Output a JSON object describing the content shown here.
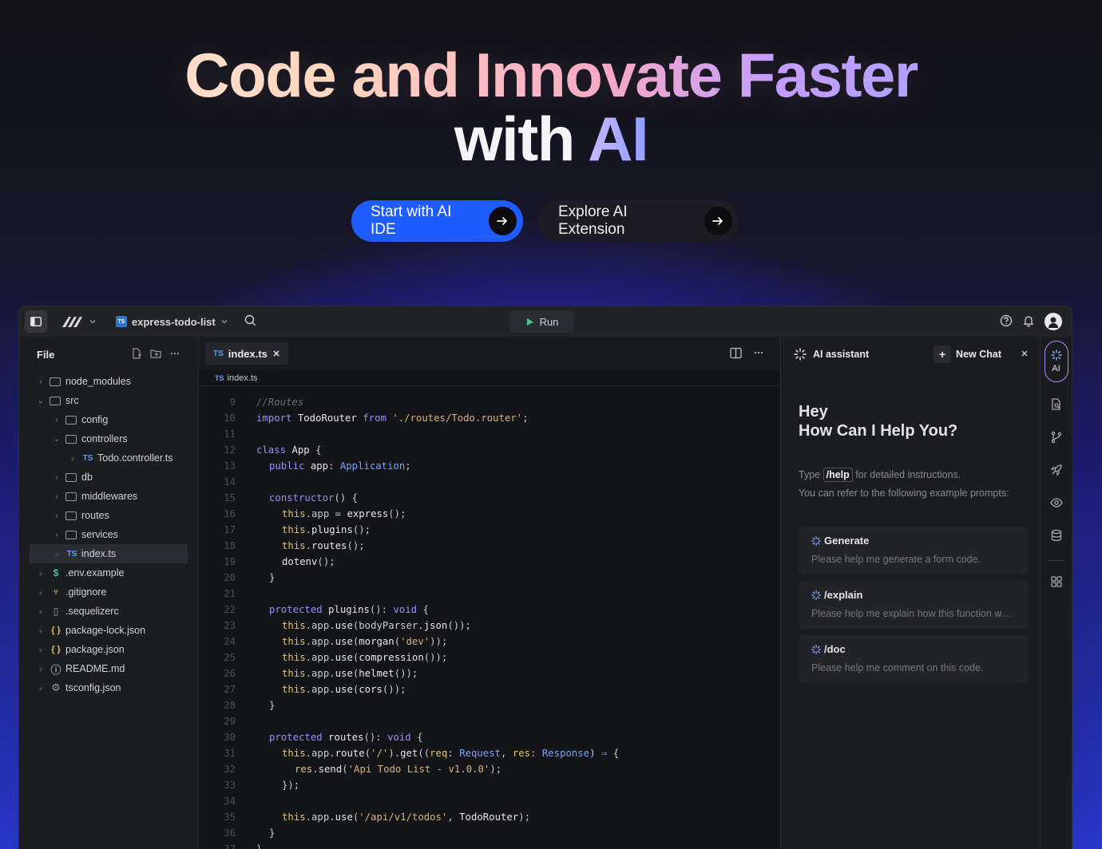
{
  "hero": {
    "title_line1_part1": "Code and Innovate Faster",
    "title_line2_part1": "with ",
    "title_line2_part2": "AI",
    "primary_cta": "Start with AI IDE",
    "secondary_cta": "Explore AI Extension"
  },
  "titlebar": {
    "project": "express-todo-list",
    "run": "Run"
  },
  "sidebar": {
    "title": "File",
    "tree": [
      {
        "label": "node_modules",
        "type": "folder",
        "depth": 0,
        "open": false
      },
      {
        "label": "src",
        "type": "folder",
        "depth": 0,
        "open": true
      },
      {
        "label": "config",
        "type": "folder",
        "depth": 1,
        "open": false
      },
      {
        "label": "controllers",
        "type": "folder",
        "depth": 1,
        "open": true
      },
      {
        "label": "Todo.controller.ts",
        "type": "ts",
        "depth": 2
      },
      {
        "label": "db",
        "type": "folder",
        "depth": 1,
        "open": false
      },
      {
        "label": "middlewares",
        "type": "folder",
        "depth": 1,
        "open": false
      },
      {
        "label": "routes",
        "type": "folder",
        "depth": 1,
        "open": false
      },
      {
        "label": "services",
        "type": "folder",
        "depth": 1,
        "open": false
      },
      {
        "label": "index.ts",
        "type": "ts",
        "depth": 1,
        "active": true
      },
      {
        "label": ".env.example",
        "type": "env",
        "depth": 0
      },
      {
        "label": ".gitignore",
        "type": "git",
        "depth": 0
      },
      {
        "label": ".sequelizerc",
        "type": "file",
        "depth": 0
      },
      {
        "label": "package-lock.json",
        "type": "json",
        "depth": 0
      },
      {
        "label": "package.json",
        "type": "json",
        "depth": 0
      },
      {
        "label": "README.md",
        "type": "md",
        "depth": 0
      },
      {
        "label": "tsconfig.json",
        "type": "config",
        "depth": 0
      }
    ]
  },
  "editor": {
    "tab": "index.ts",
    "tab_badge": "TS",
    "breadcrumb": "index.ts",
    "lines": [
      {
        "n": "9",
        "indent": 0,
        "html": "<span class='c'>//Routes</span>"
      },
      {
        "n": "10",
        "indent": 0,
        "html": "<span class='k'>import</span> <span class='f'>TodoRouter</span> <span class='k'>from</span> <span class='s'>'./routes/Todo.router'</span><span class='p'>;</span>"
      },
      {
        "n": "11",
        "indent": 0,
        "html": ""
      },
      {
        "n": "12",
        "indent": 0,
        "html": "<span class='k'>class</span> <span class='f'>App</span> <span class='p'>{</span>"
      },
      {
        "n": "13",
        "indent": 1,
        "html": "<span class='k'>public</span> <span class='f'>app</span><span class='p'>:</span> <span class='t'>Application</span><span class='p'>;</span>"
      },
      {
        "n": "14",
        "indent": 0,
        "html": ""
      },
      {
        "n": "15",
        "indent": 1,
        "html": "<span class='k'>constructor</span><span class='p'>() {</span>"
      },
      {
        "n": "16",
        "indent": 2,
        "html": "<span class='th'>this</span><span class='p'>.app = </span><span class='f'>express</span><span class='p'>();</span>"
      },
      {
        "n": "17",
        "indent": 2,
        "html": "<span class='th'>this</span><span class='p'>.</span><span class='f'>plugins</span><span class='p'>();</span>"
      },
      {
        "n": "18",
        "indent": 2,
        "html": "<span class='th'>this</span><span class='p'>.</span><span class='f'>routes</span><span class='p'>();</span>"
      },
      {
        "n": "19",
        "indent": 2,
        "html": "<span class='f'>dotenv</span><span class='p'>();</span>"
      },
      {
        "n": "20",
        "indent": 1,
        "html": "<span class='p'>}</span>"
      },
      {
        "n": "21",
        "indent": 0,
        "html": ""
      },
      {
        "n": "22",
        "indent": 1,
        "html": "<span class='k'>protected</span> <span class='f'>plugins</span><span class='p'>():</span> <span class='k'>void</span> <span class='p'>{</span>"
      },
      {
        "n": "23",
        "indent": 2,
        "html": "<span class='th'>this</span><span class='p'>.app.</span><span class='f'>use</span><span class='p'>(bodyParser.</span><span class='f'>json</span><span class='p'>());</span>"
      },
      {
        "n": "24",
        "indent": 2,
        "html": "<span class='th'>this</span><span class='p'>.app.</span><span class='f'>use</span><span class='p'>(</span><span class='f'>morgan</span><span class='p'>(</span><span class='s'>'dev'</span><span class='p'>));</span>"
      },
      {
        "n": "25",
        "indent": 2,
        "html": "<span class='th'>this</span><span class='p'>.app.</span><span class='f'>use</span><span class='p'>(</span><span class='f'>compression</span><span class='p'>());</span>"
      },
      {
        "n": "26",
        "indent": 2,
        "html": "<span class='th'>this</span><span class='p'>.app.</span><span class='f'>use</span><span class='p'>(</span><span class='f'>helmet</span><span class='p'>());</span>"
      },
      {
        "n": "27",
        "indent": 2,
        "html": "<span class='th'>this</span><span class='p'>.app.</span><span class='f'>use</span><span class='p'>(</span><span class='f'>cors</span><span class='p'>());</span>"
      },
      {
        "n": "28",
        "indent": 1,
        "html": "<span class='p'>}</span>"
      },
      {
        "n": "29",
        "indent": 0,
        "html": ""
      },
      {
        "n": "30",
        "indent": 1,
        "html": "<span class='k'>protected</span> <span class='f'>routes</span><span class='p'>():</span> <span class='k'>void</span> <span class='p'>{</span>"
      },
      {
        "n": "31",
        "indent": 2,
        "html": "<span class='th'>this</span><span class='p'>.app.</span><span class='f'>route</span><span class='p'>(</span><span class='s'>'/'</span><span class='p'>).</span><span class='f'>get</span><span class='p'>((</span><span class='th'>req</span><span class='p'>:</span> <span class='t'>Request</span><span class='p'>,</span> <span class='th'>res</span><span class='p'>:</span> <span class='t'>Response</span><span class='p'>)</span> <span class='k'>⇒</span> <span class='p'>{</span>"
      },
      {
        "n": "32",
        "indent": 3,
        "html": "<span class='th'>res</span><span class='p'>.</span><span class='f'>send</span><span class='p'>(</span><span class='s'>'Api Todo List - v1.0.0'</span><span class='p'>);</span>"
      },
      {
        "n": "33",
        "indent": 2,
        "html": "<span class='p'>});</span>"
      },
      {
        "n": "34",
        "indent": 0,
        "html": ""
      },
      {
        "n": "35",
        "indent": 2,
        "html": "<span class='th'>this</span><span class='p'>.app.</span><span class='f'>use</span><span class='p'>(</span><span class='s'>'/api/v1/todos'</span><span class='p'>,</span> <span class='f'>TodoRouter</span><span class='p'>);</span>"
      },
      {
        "n": "36",
        "indent": 1,
        "html": "<span class='p'>}</span>"
      },
      {
        "n": "37",
        "indent": 0,
        "html": "<span class='p'>}</span>"
      }
    ]
  },
  "assistant": {
    "title": "AI assistant",
    "new_chat": "New Chat",
    "greet_line1": "Hey",
    "greet_line2": "How Can I Help You?",
    "help_prefix": "Type",
    "help_cmd": "/help",
    "help_suffix": "for detailed instructions.",
    "help_line2": "You can refer to the following example prompts:",
    "prompts": [
      {
        "title": "Generate",
        "desc": "Please help me generate a form code."
      },
      {
        "title": "/explain",
        "desc": "Please help me explain how this function works."
      },
      {
        "title": "/doc",
        "desc": "Please help me comment on this code."
      }
    ]
  },
  "rail": {
    "ai_label": "AI"
  }
}
